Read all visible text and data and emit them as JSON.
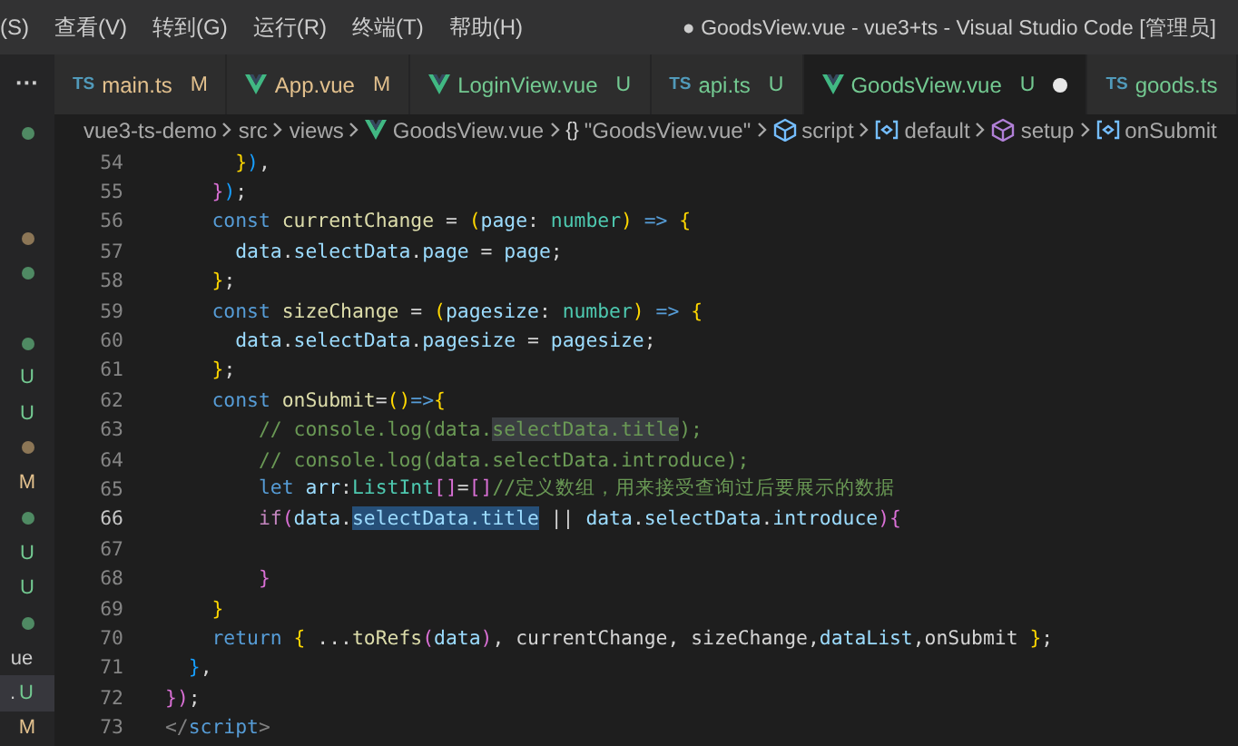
{
  "menu": [
    "(S)",
    "查看(V)",
    "转到(G)",
    "运行(R)",
    "终端(T)",
    "帮助(H)"
  ],
  "window": {
    "title": "● GoodsView.vue - vue3+ts - Visual Studio Code [管理员]"
  },
  "sidebar": {
    "more": "···",
    "items": [
      {
        "kind": "dot",
        "color": "#4f8a63",
        "selected": false
      },
      {
        "kind": "blank",
        "selected": false
      },
      {
        "kind": "blank",
        "selected": false
      },
      {
        "kind": "dot",
        "color": "#8c7656",
        "selected": false
      },
      {
        "kind": "dot",
        "color": "#4f8a63",
        "selected": false
      },
      {
        "kind": "blank",
        "selected": false
      },
      {
        "kind": "dot",
        "color": "#4f8a63",
        "selected": false
      },
      {
        "kind": "file",
        "status": "U",
        "color": "#73c991",
        "selected": false
      },
      {
        "kind": "file",
        "status": "U",
        "color": "#73c991",
        "selected": false
      },
      {
        "kind": "dot",
        "color": "#8c7656",
        "selected": false
      },
      {
        "kind": "file",
        "status": "M",
        "color": "#e2c08d",
        "selected": false
      },
      {
        "kind": "dot",
        "color": "#4f8a63",
        "selected": false
      },
      {
        "kind": "file",
        "status": "U",
        "color": "#73c991",
        "selected": false
      },
      {
        "kind": "file",
        "status": "U",
        "color": "#73c991",
        "selected": false
      },
      {
        "kind": "dot",
        "color": "#4f8a63",
        "selected": false
      },
      {
        "kind": "file",
        "label": "ue",
        "selected": false
      },
      {
        "kind": "file",
        "label": ".",
        "status": "U",
        "color": "#73c991",
        "selected": true
      },
      {
        "kind": "file",
        "status": "M",
        "color": "#e2c08d",
        "selected": false
      }
    ]
  },
  "tabs": [
    {
      "kind": "ts",
      "icon_text": "TS",
      "label": "main.ts",
      "status": "M",
      "color": "#e2c08d",
      "selected": false,
      "dirty": false
    },
    {
      "kind": "vue",
      "label": "App.vue",
      "status": "M",
      "color": "#e2c08d",
      "selected": false,
      "dirty": false
    },
    {
      "kind": "vue",
      "label": "LoginView.vue",
      "status": "U",
      "color": "#73c991",
      "selected": false,
      "dirty": false
    },
    {
      "kind": "ts",
      "icon_text": "TS",
      "label": "api.ts",
      "status": "U",
      "color": "#73c991",
      "selected": false,
      "dirty": false
    },
    {
      "kind": "vue",
      "label": "GoodsView.vue",
      "status": "U",
      "color": "#73c991",
      "selected": true,
      "dirty": true
    },
    {
      "kind": "ts",
      "icon_text": "TS",
      "label": "goods.ts",
      "color": "#73c991",
      "selected": false,
      "dirty": false
    }
  ],
  "breadcrumb": [
    {
      "label": "vue3-ts-demo"
    },
    {
      "label": "src"
    },
    {
      "label": "views"
    },
    {
      "kind": "vue",
      "label": "GoodsView.vue"
    },
    {
      "kind": "braces",
      "icon_text": "{}",
      "label": "\"GoodsView.vue\""
    },
    {
      "kind": "cube",
      "label": "script"
    },
    {
      "kind": "variable",
      "label": "default"
    },
    {
      "kind": "method",
      "label": "setup"
    },
    {
      "kind": "variable",
      "label": "onSubmit"
    }
  ],
  "editor": {
    "lines": [
      {
        "number": "54",
        "current": false,
        "tokens": [
          {
            "kind": "b1",
            "text": "      }"
          },
          {
            "kind": "b3",
            "text": ")"
          },
          {
            "kind": "plain",
            "text": ","
          }
        ]
      },
      {
        "number": "55",
        "current": false,
        "tokens": [
          {
            "kind": "b2",
            "text": "    }"
          },
          {
            "kind": "b3",
            "text": ")"
          },
          {
            "kind": "plain",
            "text": ";"
          }
        ]
      },
      {
        "number": "56",
        "current": false,
        "tokens": [
          {
            "kind": "kw",
            "text": "    const"
          },
          {
            "kind": "fn",
            "text": " currentChange"
          },
          {
            "kind": "plain",
            "text": " = "
          },
          {
            "kind": "b1",
            "text": "("
          },
          {
            "kind": "var",
            "text": "page"
          },
          {
            "kind": "plain",
            "text": ": "
          },
          {
            "kind": "type",
            "text": "number"
          },
          {
            "kind": "b1",
            "text": ")"
          },
          {
            "kind": "kw",
            "text": " =>"
          },
          {
            "kind": "b1",
            "text": " {"
          }
        ]
      },
      {
        "number": "57",
        "current": false,
        "tokens": [
          {
            "kind": "var",
            "text": "      data"
          },
          {
            "kind": "plain",
            "text": "."
          },
          {
            "kind": "var",
            "text": "selectData"
          },
          {
            "kind": "plain",
            "text": "."
          },
          {
            "kind": "var",
            "text": "page"
          },
          {
            "kind": "plain",
            "text": " = "
          },
          {
            "kind": "var",
            "text": "page"
          },
          {
            "kind": "plain",
            "text": ";"
          }
        ]
      },
      {
        "number": "58",
        "current": false,
        "tokens": [
          {
            "kind": "b1",
            "text": "    }"
          },
          {
            "kind": "plain",
            "text": ";"
          }
        ]
      },
      {
        "number": "59",
        "current": false,
        "tokens": [
          {
            "kind": "kw",
            "text": "    const"
          },
          {
            "kind": "fn",
            "text": " sizeChange"
          },
          {
            "kind": "plain",
            "text": " = "
          },
          {
            "kind": "b1",
            "text": "("
          },
          {
            "kind": "var",
            "text": "pagesize"
          },
          {
            "kind": "plain",
            "text": ": "
          },
          {
            "kind": "type",
            "text": "number"
          },
          {
            "kind": "b1",
            "text": ")"
          },
          {
            "kind": "kw",
            "text": " =>"
          },
          {
            "kind": "b1",
            "text": " {"
          }
        ]
      },
      {
        "number": "60",
        "current": false,
        "tokens": [
          {
            "kind": "var",
            "text": "      data"
          },
          {
            "kind": "plain",
            "text": "."
          },
          {
            "kind": "var",
            "text": "selectData"
          },
          {
            "kind": "plain",
            "text": "."
          },
          {
            "kind": "var",
            "text": "pagesize"
          },
          {
            "kind": "plain",
            "text": " = "
          },
          {
            "kind": "var",
            "text": "pagesize"
          },
          {
            "kind": "plain",
            "text": ";"
          }
        ]
      },
      {
        "number": "61",
        "current": false,
        "tokens": [
          {
            "kind": "b1",
            "text": "    }"
          },
          {
            "kind": "plain",
            "text": ";"
          }
        ]
      },
      {
        "number": "62",
        "current": false,
        "tokens": [
          {
            "kind": "kw",
            "text": "    const"
          },
          {
            "kind": "fn",
            "text": " onSubmit"
          },
          {
            "kind": "plain",
            "text": "="
          },
          {
            "kind": "b1",
            "text": "()"
          },
          {
            "kind": "kw",
            "text": "=>"
          },
          {
            "kind": "b1",
            "text": "{"
          }
        ]
      },
      {
        "number": "63",
        "current": false,
        "tokens": [
          {
            "kind": "cmt",
            "text": "        // console.log(data."
          },
          {
            "kind": "cmt",
            "text": "selectData.title",
            "highlighted": true
          },
          {
            "kind": "cmt",
            "text": ");"
          }
        ]
      },
      {
        "number": "64",
        "current": false,
        "tokens": [
          {
            "kind": "cmt",
            "text": "        // console.log(data.selectData.introduce);"
          }
        ]
      },
      {
        "number": "65",
        "current": false,
        "tokens": [
          {
            "kind": "kw",
            "text": "        let"
          },
          {
            "kind": "var",
            "text": " arr"
          },
          {
            "kind": "plain",
            "text": ":"
          },
          {
            "kind": "type",
            "text": "ListInt"
          },
          {
            "kind": "b2",
            "text": "[]"
          },
          {
            "kind": "plain",
            "text": "="
          },
          {
            "kind": "b2",
            "text": "[]"
          },
          {
            "kind": "cmt",
            "text": "//定义数组，用来接受查询过后要展示的数据"
          }
        ]
      },
      {
        "number": "66",
        "current": true,
        "tokens": [
          {
            "kind": "ctrl",
            "text": "        if"
          },
          {
            "kind": "b2",
            "text": "("
          },
          {
            "kind": "var",
            "text": "data"
          },
          {
            "kind": "plain",
            "text": "."
          },
          {
            "kind": "var",
            "text": "selectData.title",
            "selected": true
          },
          {
            "kind": "plain",
            "text": " || "
          },
          {
            "kind": "var",
            "text": "data"
          },
          {
            "kind": "plain",
            "text": "."
          },
          {
            "kind": "var",
            "text": "selectData"
          },
          {
            "kind": "plain",
            "text": "."
          },
          {
            "kind": "var",
            "text": "introduce"
          },
          {
            "kind": "b2",
            "text": ")"
          },
          {
            "kind": "b2",
            "text": "{"
          }
        ]
      },
      {
        "number": "67",
        "current": false
      },
      {
        "number": "68",
        "current": false,
        "tokens": [
          {
            "kind": "b2",
            "text": "        }"
          }
        ]
      },
      {
        "number": "69",
        "current": false,
        "tokens": [
          {
            "kind": "b1",
            "text": "    }"
          }
        ]
      },
      {
        "number": "70",
        "current": false,
        "tokens": [
          {
            "kind": "kw",
            "text": "    return"
          },
          {
            "kind": "b1",
            "text": " {"
          },
          {
            "kind": "plain",
            "text": " ..."
          },
          {
            "kind": "fn",
            "text": "toRefs"
          },
          {
            "kind": "b2",
            "text": "("
          },
          {
            "kind": "var",
            "text": "data"
          },
          {
            "kind": "b2",
            "text": ")"
          },
          {
            "kind": "plain",
            "text": ", currentChange, sizeChange,"
          },
          {
            "kind": "var",
            "text": "dataList"
          },
          {
            "kind": "plain",
            "text": ",onSubmit "
          },
          {
            "kind": "b1",
            "text": "}"
          },
          {
            "kind": "plain",
            "text": ";"
          }
        ]
      },
      {
        "number": "71",
        "current": false,
        "tokens": [
          {
            "kind": "b3",
            "text": "  }"
          },
          {
            "kind": "plain",
            "text": ","
          }
        ]
      },
      {
        "number": "72",
        "current": false,
        "tokens": [
          {
            "kind": "b2",
            "text": "}"
          },
          {
            "kind": "b2",
            "text": ")"
          },
          {
            "kind": "plain",
            "text": ";"
          }
        ]
      },
      {
        "number": "73",
        "current": false,
        "tokens": [
          {
            "kind": "punct",
            "text": "</"
          },
          {
            "kind": "kw",
            "text": "script"
          },
          {
            "kind": "punct",
            "text": ">"
          }
        ]
      }
    ]
  }
}
